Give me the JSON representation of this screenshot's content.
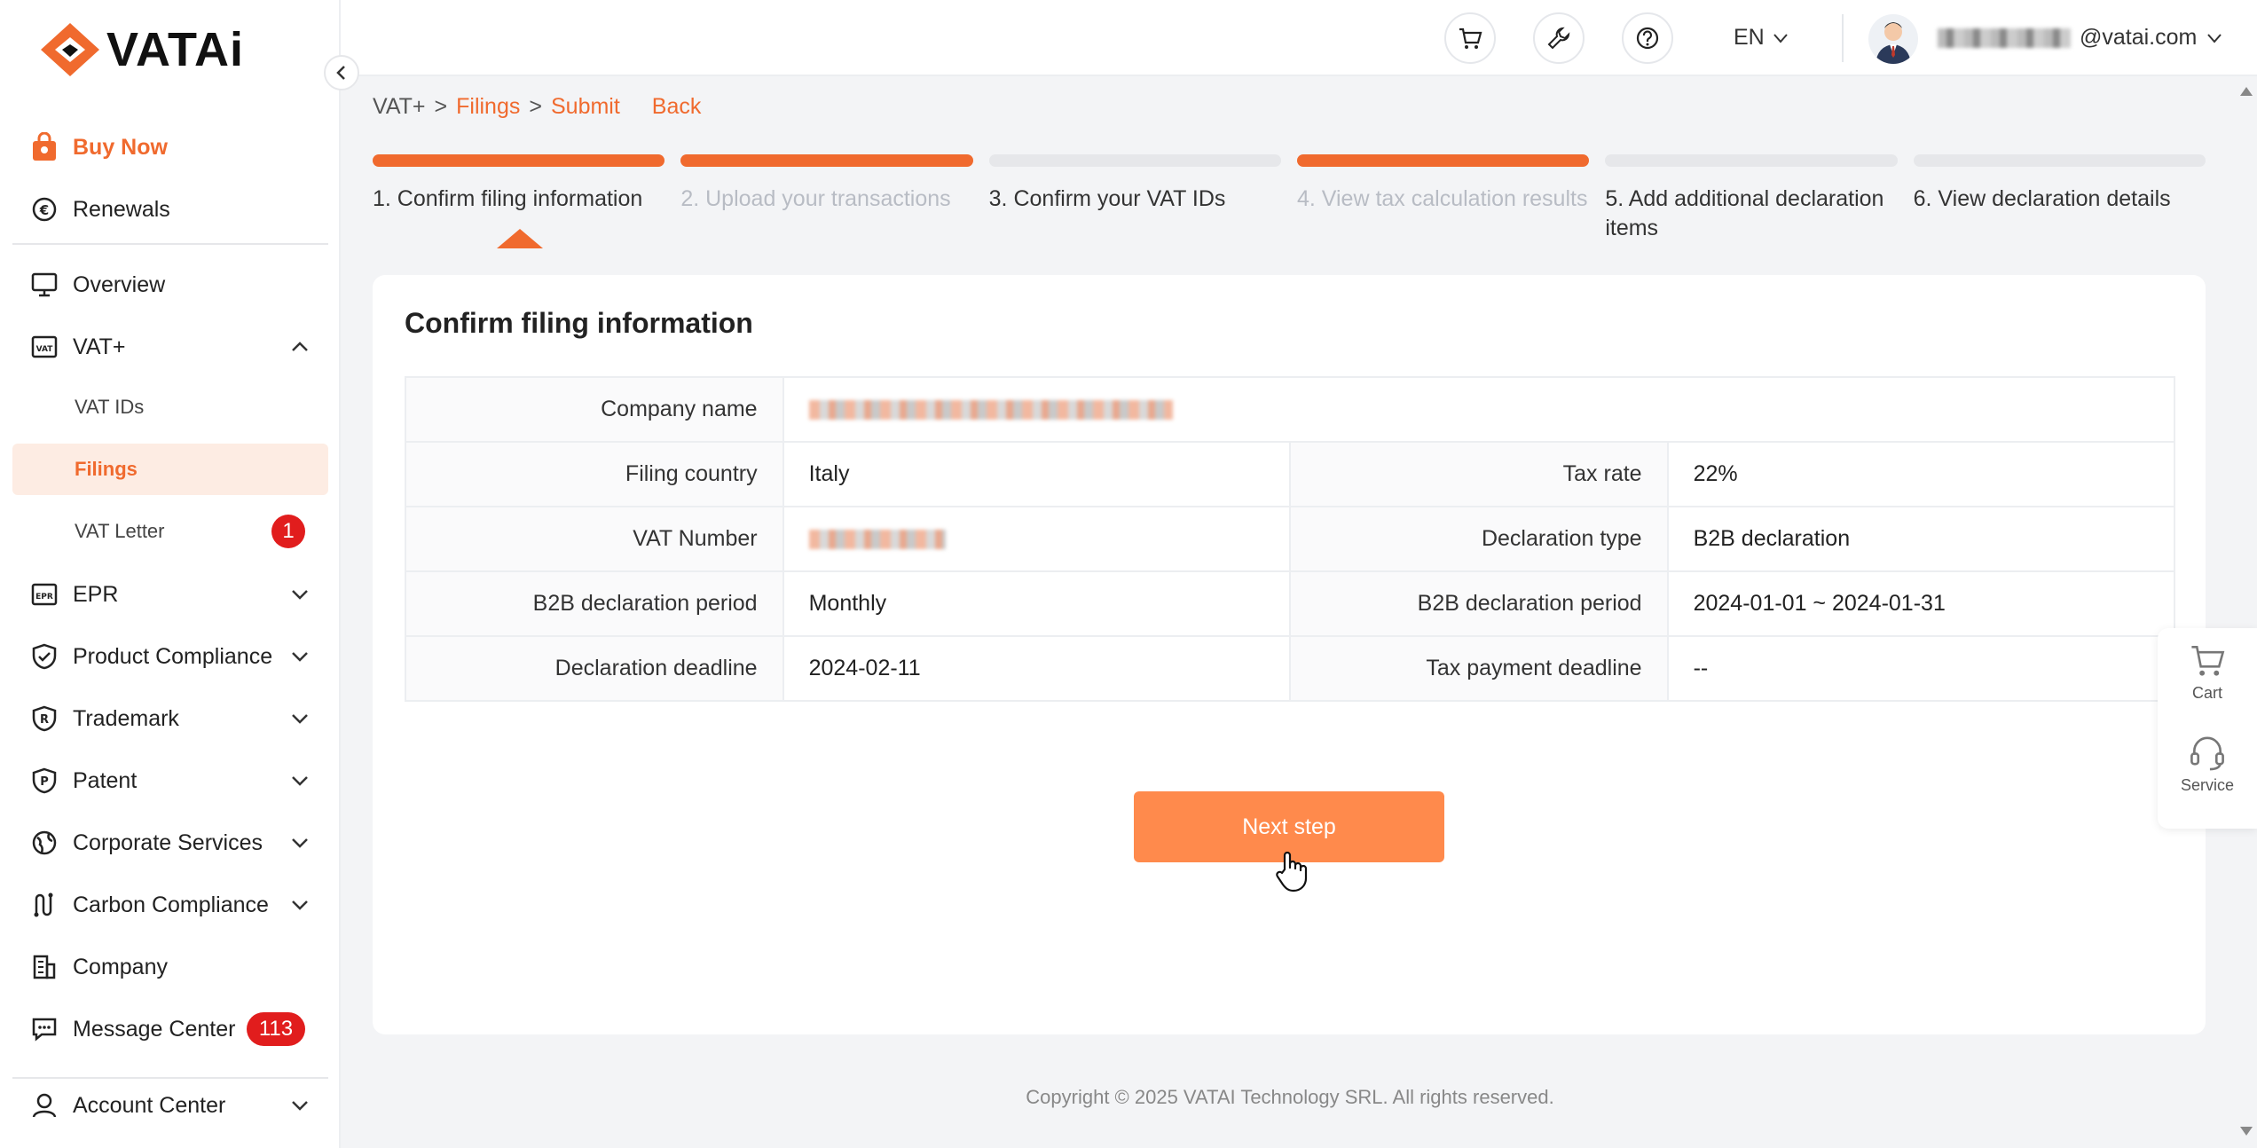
{
  "brand": {
    "name": "VATAi",
    "accent": "#f06a2e"
  },
  "sidebar": {
    "buy_now": "Buy Now",
    "renewals": "Renewals",
    "items": [
      {
        "label": "Overview"
      },
      {
        "label": "VAT+"
      },
      {
        "label": "VAT IDs"
      },
      {
        "label": "Filings"
      },
      {
        "label": "VAT Letter",
        "badge": "1"
      },
      {
        "label": "EPR"
      },
      {
        "label": "Product Compliance"
      },
      {
        "label": "Trademark"
      },
      {
        "label": "Patent"
      },
      {
        "label": "Corporate Services"
      },
      {
        "label": "Carbon Compliance"
      },
      {
        "label": "Company"
      },
      {
        "label": "Message Center",
        "badge": "113"
      },
      {
        "label": "Account Center"
      }
    ]
  },
  "header": {
    "language": "EN",
    "email_suffix": "@vatai.com"
  },
  "breadcrumb": {
    "root": "VAT+",
    "sep": ">",
    "filings": "Filings",
    "submit": "Submit",
    "back": "Back"
  },
  "steps": [
    {
      "label": "1. Confirm filing information",
      "state": "done"
    },
    {
      "label": "2. Upload your transactions",
      "state": "done-muted"
    },
    {
      "label": "3. Confirm your VAT IDs",
      "state": "pending"
    },
    {
      "label": "4. View tax calculation results",
      "state": "done-muted"
    },
    {
      "label": "5. Add additional declaration items",
      "state": "pending"
    },
    {
      "label": "6. View declaration details",
      "state": "pending"
    }
  ],
  "card": {
    "title": "Confirm filing information",
    "rows": {
      "company_name_label": "Company name",
      "filing_country_label": "Filing country",
      "filing_country": "Italy",
      "tax_rate_label": "Tax rate",
      "tax_rate": "22%",
      "vat_number_label": "VAT Number",
      "declaration_type_label": "Declaration type",
      "declaration_type": "B2B declaration",
      "b2b_period_label": "B2B declaration period",
      "b2b_period": "Monthly",
      "b2b_period_label_2": "B2B declaration period",
      "b2b_period_range": "2024-01-01 ~ 2024-01-31",
      "declaration_deadline_label": "Declaration deadline",
      "declaration_deadline": "2024-02-11",
      "tax_payment_deadline_label": "Tax payment deadline",
      "tax_payment_deadline": "--"
    },
    "next_button": "Next step"
  },
  "footer": "Copyright © 2025 VATAI Technology SRL. All rights reserved.",
  "float_panel": {
    "cart": "Cart",
    "service": "Service"
  }
}
